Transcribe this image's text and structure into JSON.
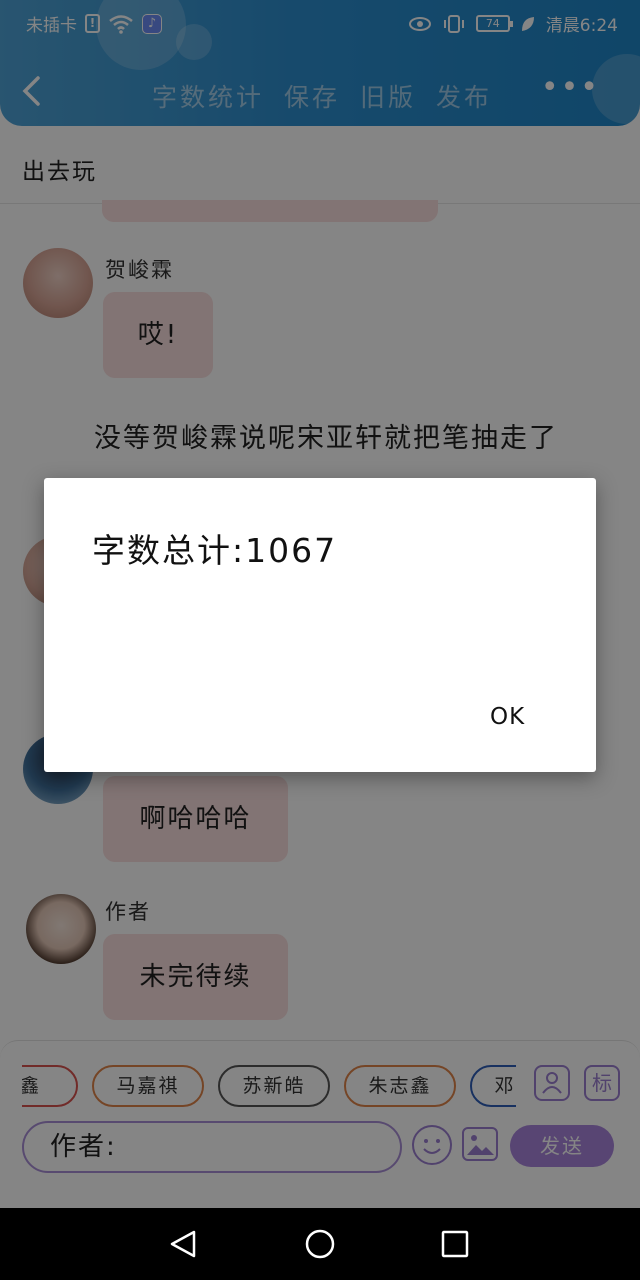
{
  "status_bar": {
    "carrier": "未插卡",
    "battery": "74",
    "time": "清晨6:24"
  },
  "header": {
    "actions": [
      "字数统计",
      "保存",
      "旧版",
      "发布"
    ]
  },
  "chat": {
    "title": "出去玩",
    "messages": [
      {
        "sender": "贺峻霖",
        "text": "哎!"
      },
      {
        "sender": "作者",
        "text": "啊哈哈哈"
      },
      {
        "sender": "作者",
        "text": "未完待续"
      }
    ],
    "narration": "　　没等贺峻霖说呢宋亚轩就把笔抽走了"
  },
  "composer": {
    "chips": [
      "星鑫",
      "马嘉祺",
      "苏新皓",
      "朱志鑫",
      "邓佳鑫"
    ],
    "chip_colors": [
      "#d9534f",
      "#e0854a",
      "#555555",
      "#e0854a",
      "#2f5fb8"
    ],
    "tag_label": "标",
    "input_value": "作者:",
    "send_label": "发送"
  },
  "dialog": {
    "message": "字数总计:1067",
    "ok_label": "OK"
  }
}
